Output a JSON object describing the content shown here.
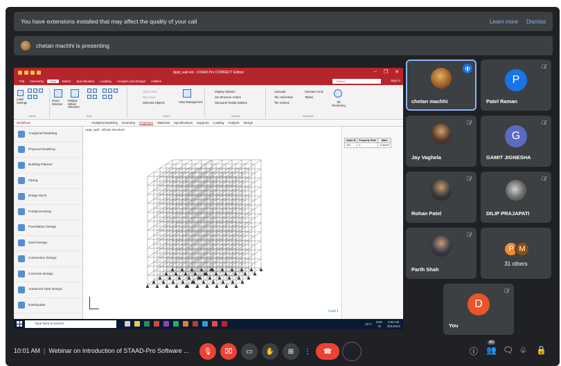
{
  "colors": {
    "meet_bg": "#202124",
    "tile_bg": "#3c4043",
    "link": "#8ab4f8",
    "staad_red": "#b7252c",
    "end_call": "#ea4335"
  },
  "banners": {
    "extensions_msg": "You have extensions installed that may affect the quality of your call",
    "learn_more": "Learn more",
    "dismiss": "Dismiss",
    "presenting": "chetan machhi is presenting"
  },
  "staad": {
    "window_title": "Appt_wall.std - STAAD.Pro CONNECT Edition",
    "menu": [
      "File",
      "Geometry",
      "View",
      "Select",
      "Specification",
      "Loading",
      "Analysis and Design",
      "Utilities"
    ],
    "active_menu": "View",
    "search_placeholder": "Search",
    "sign_in": "Sign in",
    "ribbon": {
      "label_settings": "Label Settings",
      "labels_group": "Labels",
      "zoom_window": "Zoom Window",
      "display_whole": "Display Whole Structure",
      "tools_group": "Tools",
      "open_view": "Open View",
      "new_view": "New View",
      "selected_objects": "Selected Objects",
      "view_management": "View Management",
      "views_group": "Views",
      "display_options": "Display Options",
      "set_structure_colors": "Set Structure Colors",
      "structural_tooltip": "Structural Tooltip Options",
      "options_group": "Options",
      "cascade": "Cascade",
      "tile_horizontal": "Tile Horizontal",
      "tile_vertical": "Tile Vertical",
      "structure_only": "Structure Only",
      "tables": "Tables",
      "windows_group": "Windows",
      "rendering": "3D Rendering"
    },
    "workflows_label": "Workflows",
    "sub_tabs": [
      "Analytical Modeling",
      "Geometry",
      "Properties",
      "Materials",
      "Specifications",
      "Supports",
      "Loading",
      "Analysis",
      "Design"
    ],
    "active_sub_tab": "Properties",
    "workflow_items": [
      "Analytical Modeling",
      "Physical Modeling",
      "Building Planner",
      "Piping",
      "Bridge Deck",
      "Postprocessing",
      "Foundation Design",
      "Steel Design",
      "Connection Design",
      "Concrete Design",
      "Advanced Slab Design",
      "Earthquake"
    ],
    "viewport_title": "Appt_wall - Whole Structure",
    "load_label": "Load 1",
    "table": {
      "headers": [
        "Node B",
        "Property Refe",
        "Mate"
      ],
      "row": [
        "120",
        "2",
        "CONCR"
      ]
    },
    "taskbar": {
      "search_placeholder": "Type here to search",
      "weather": "26°C",
      "lang_top": "ENG",
      "lang_bottom": "IN",
      "time": "9:58 AM",
      "date": "3/31/2022"
    }
  },
  "participants": [
    {
      "name": "chetan machhi",
      "type": "photo",
      "speaking": true,
      "muted": false
    },
    {
      "name": "Patel Raman",
      "type": "letter",
      "letter": "P",
      "color": "#1a73e8",
      "muted": true
    },
    {
      "name": "Jay Vaghela",
      "type": "photo",
      "muted": true
    },
    {
      "name": "GAMIT JIGNESHA",
      "type": "letter",
      "letter": "G",
      "color": "#5c6bc0",
      "muted": true
    },
    {
      "name": "Rohan Patel",
      "type": "photo",
      "muted": true
    },
    {
      "name": "DILIP PRAJAPATI",
      "type": "photo",
      "muted": true
    },
    {
      "name": "Parth Shah",
      "type": "photo",
      "muted": true
    },
    {
      "name": "You",
      "type": "letter",
      "letter": "D",
      "color": "#e8552a",
      "muted": true
    }
  ],
  "others": {
    "label": "31 others",
    "avatars": [
      {
        "letter": "P",
        "color": "#f28b30"
      },
      {
        "letter": "M",
        "color": "#8d4e12"
      }
    ]
  },
  "bottom": {
    "time": "10:01 AM",
    "meeting_title": "Webinar on Introduction of STAAD-Pro Software ...",
    "people_count": "40"
  },
  "icons": {
    "mic_off": "mic-off-icon",
    "cam_off": "camera-off-icon",
    "captions": "captions-icon",
    "raise_hand": "raise-hand-icon",
    "present": "present-icon",
    "more": "more-options-icon",
    "end_call": "end-call-icon",
    "info": "info-icon",
    "people": "people-icon",
    "chat": "chat-icon",
    "activities": "activities-icon",
    "host_controls": "host-controls-icon"
  }
}
